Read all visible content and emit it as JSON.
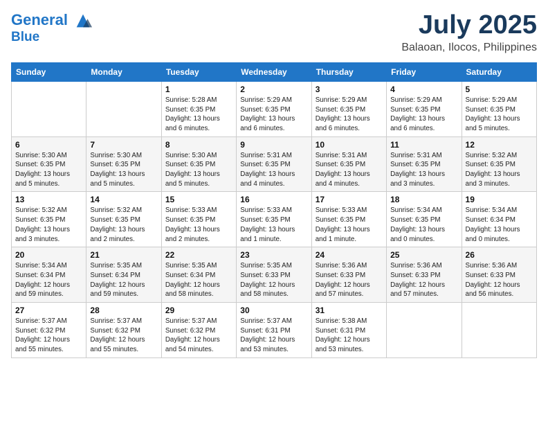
{
  "logo": {
    "line1": "General",
    "line2": "Blue"
  },
  "title": "July 2025",
  "subtitle": "Balaoan, Ilocos, Philippines",
  "days_of_week": [
    "Sunday",
    "Monday",
    "Tuesday",
    "Wednesday",
    "Thursday",
    "Friday",
    "Saturday"
  ],
  "weeks": [
    [
      {
        "day": "",
        "info": ""
      },
      {
        "day": "",
        "info": ""
      },
      {
        "day": "1",
        "info": "Sunrise: 5:28 AM\nSunset: 6:35 PM\nDaylight: 13 hours and 6 minutes."
      },
      {
        "day": "2",
        "info": "Sunrise: 5:29 AM\nSunset: 6:35 PM\nDaylight: 13 hours and 6 minutes."
      },
      {
        "day": "3",
        "info": "Sunrise: 5:29 AM\nSunset: 6:35 PM\nDaylight: 13 hours and 6 minutes."
      },
      {
        "day": "4",
        "info": "Sunrise: 5:29 AM\nSunset: 6:35 PM\nDaylight: 13 hours and 6 minutes."
      },
      {
        "day": "5",
        "info": "Sunrise: 5:29 AM\nSunset: 6:35 PM\nDaylight: 13 hours and 5 minutes."
      }
    ],
    [
      {
        "day": "6",
        "info": "Sunrise: 5:30 AM\nSunset: 6:35 PM\nDaylight: 13 hours and 5 minutes."
      },
      {
        "day": "7",
        "info": "Sunrise: 5:30 AM\nSunset: 6:35 PM\nDaylight: 13 hours and 5 minutes."
      },
      {
        "day": "8",
        "info": "Sunrise: 5:30 AM\nSunset: 6:35 PM\nDaylight: 13 hours and 5 minutes."
      },
      {
        "day": "9",
        "info": "Sunrise: 5:31 AM\nSunset: 6:35 PM\nDaylight: 13 hours and 4 minutes."
      },
      {
        "day": "10",
        "info": "Sunrise: 5:31 AM\nSunset: 6:35 PM\nDaylight: 13 hours and 4 minutes."
      },
      {
        "day": "11",
        "info": "Sunrise: 5:31 AM\nSunset: 6:35 PM\nDaylight: 13 hours and 3 minutes."
      },
      {
        "day": "12",
        "info": "Sunrise: 5:32 AM\nSunset: 6:35 PM\nDaylight: 13 hours and 3 minutes."
      }
    ],
    [
      {
        "day": "13",
        "info": "Sunrise: 5:32 AM\nSunset: 6:35 PM\nDaylight: 13 hours and 3 minutes."
      },
      {
        "day": "14",
        "info": "Sunrise: 5:32 AM\nSunset: 6:35 PM\nDaylight: 13 hours and 2 minutes."
      },
      {
        "day": "15",
        "info": "Sunrise: 5:33 AM\nSunset: 6:35 PM\nDaylight: 13 hours and 2 minutes."
      },
      {
        "day": "16",
        "info": "Sunrise: 5:33 AM\nSunset: 6:35 PM\nDaylight: 13 hours and 1 minute."
      },
      {
        "day": "17",
        "info": "Sunrise: 5:33 AM\nSunset: 6:35 PM\nDaylight: 13 hours and 1 minute."
      },
      {
        "day": "18",
        "info": "Sunrise: 5:34 AM\nSunset: 6:35 PM\nDaylight: 13 hours and 0 minutes."
      },
      {
        "day": "19",
        "info": "Sunrise: 5:34 AM\nSunset: 6:34 PM\nDaylight: 13 hours and 0 minutes."
      }
    ],
    [
      {
        "day": "20",
        "info": "Sunrise: 5:34 AM\nSunset: 6:34 PM\nDaylight: 12 hours and 59 minutes."
      },
      {
        "day": "21",
        "info": "Sunrise: 5:35 AM\nSunset: 6:34 PM\nDaylight: 12 hours and 59 minutes."
      },
      {
        "day": "22",
        "info": "Sunrise: 5:35 AM\nSunset: 6:34 PM\nDaylight: 12 hours and 58 minutes."
      },
      {
        "day": "23",
        "info": "Sunrise: 5:35 AM\nSunset: 6:33 PM\nDaylight: 12 hours and 58 minutes."
      },
      {
        "day": "24",
        "info": "Sunrise: 5:36 AM\nSunset: 6:33 PM\nDaylight: 12 hours and 57 minutes."
      },
      {
        "day": "25",
        "info": "Sunrise: 5:36 AM\nSunset: 6:33 PM\nDaylight: 12 hours and 57 minutes."
      },
      {
        "day": "26",
        "info": "Sunrise: 5:36 AM\nSunset: 6:33 PM\nDaylight: 12 hours and 56 minutes."
      }
    ],
    [
      {
        "day": "27",
        "info": "Sunrise: 5:37 AM\nSunset: 6:32 PM\nDaylight: 12 hours and 55 minutes."
      },
      {
        "day": "28",
        "info": "Sunrise: 5:37 AM\nSunset: 6:32 PM\nDaylight: 12 hours and 55 minutes."
      },
      {
        "day": "29",
        "info": "Sunrise: 5:37 AM\nSunset: 6:32 PM\nDaylight: 12 hours and 54 minutes."
      },
      {
        "day": "30",
        "info": "Sunrise: 5:37 AM\nSunset: 6:31 PM\nDaylight: 12 hours and 53 minutes."
      },
      {
        "day": "31",
        "info": "Sunrise: 5:38 AM\nSunset: 6:31 PM\nDaylight: 12 hours and 53 minutes."
      },
      {
        "day": "",
        "info": ""
      },
      {
        "day": "",
        "info": ""
      }
    ]
  ]
}
